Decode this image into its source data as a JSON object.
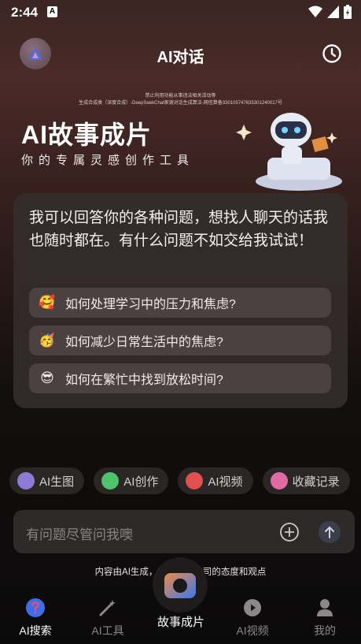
{
  "status_bar": {
    "time": "2:44",
    "badge": "A"
  },
  "header": {
    "title": "AI对话",
    "logo_icon": "triangle-logo-icon",
    "history_icon": "clock-icon"
  },
  "notice": {
    "line1": "禁止利用功能从事违法相关活动等",
    "line2": "生成合成类（深度合成）-DeepSeekChat家谢对话生成算法-网信算备330105747635301240017号"
  },
  "banner": {
    "title": "AI故事成片",
    "subtitle": "你的专属灵感创作工具"
  },
  "card": {
    "intro": "我可以回答你的各种问题，想找人聊天的话我也随时都在。有什么问题不如交给我试试！",
    "suggestions": [
      {
        "emoji": "🥰",
        "text": "如何处理学习中的压力和焦虑?"
      },
      {
        "emoji": "🥳",
        "text": "如何减少日常生活中的焦虑?"
      },
      {
        "emoji": "😎",
        "text": "如何在繁忙中找到放松时间?"
      }
    ]
  },
  "chips": [
    {
      "label": "AI生图",
      "color": "#8e7ad6"
    },
    {
      "label": "AI创作",
      "color": "#4fc36b"
    },
    {
      "label": "AI视频",
      "color": "#e05050"
    },
    {
      "label": "收藏记录",
      "color": "#e06aa4"
    }
  ],
  "input": {
    "placeholder": "有问题尽管问我噢"
  },
  "disclaimer": "内容由AI生成，不代表本公司的态度和观点",
  "nav": {
    "items": [
      {
        "label": "AI搜索",
        "active": true
      },
      {
        "label": "AI工具",
        "active": false
      },
      {
        "label": "故事成片",
        "active": true
      },
      {
        "label": "AI视频",
        "active": false
      },
      {
        "label": "我的",
        "active": false
      }
    ]
  },
  "colors": {
    "accent_blue": "#3d6ee8",
    "chip_bg": "#2a2626",
    "card_bg": "#342c2c"
  }
}
